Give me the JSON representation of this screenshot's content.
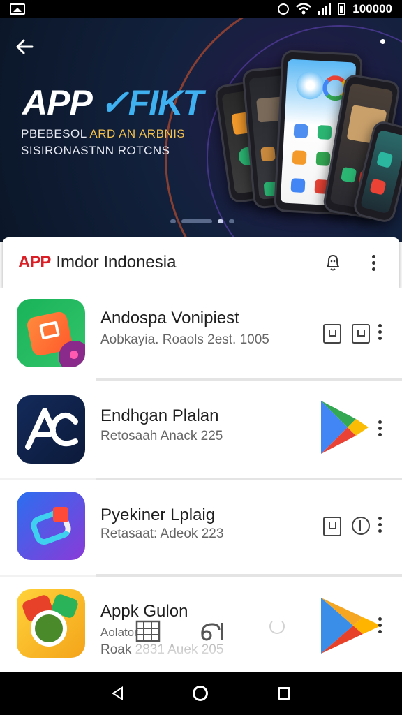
{
  "status_bar": {
    "time": "100000"
  },
  "hero": {
    "title_main": "APP",
    "title_accent": "✓FIKT",
    "subtitle_line1_a": "PBEBESOL",
    "subtitle_line1_b": "ARD AN ARBNIS",
    "subtitle_line2": "SISIRONASTNN ROTCNS"
  },
  "header": {
    "brand": "APP",
    "title": "Imdor Indonesia"
  },
  "apps": [
    {
      "name": "Andospa Vonipiest",
      "meta": "Aobkayia. Roaols 2est. 1005"
    },
    {
      "name": "Endhgan Plalan",
      "meta": "Retosaah  Anack 225"
    },
    {
      "name": "Pyekiner Lplaig",
      "meta": "Retasaat:  Adeok 223"
    },
    {
      "name": "Appk Gulon",
      "meta_line1": "Aolator",
      "meta_line2": "Roak 2831  Auek 205"
    }
  ],
  "icons": {
    "back": "arrow-left-icon",
    "bell": "bell-icon",
    "more": "more-vert-icon",
    "play": "play-store-icon"
  },
  "colors": {
    "brand_red": "#d92027",
    "hero_bg": "#12213d",
    "accent_blue": "#3fb0f0"
  }
}
